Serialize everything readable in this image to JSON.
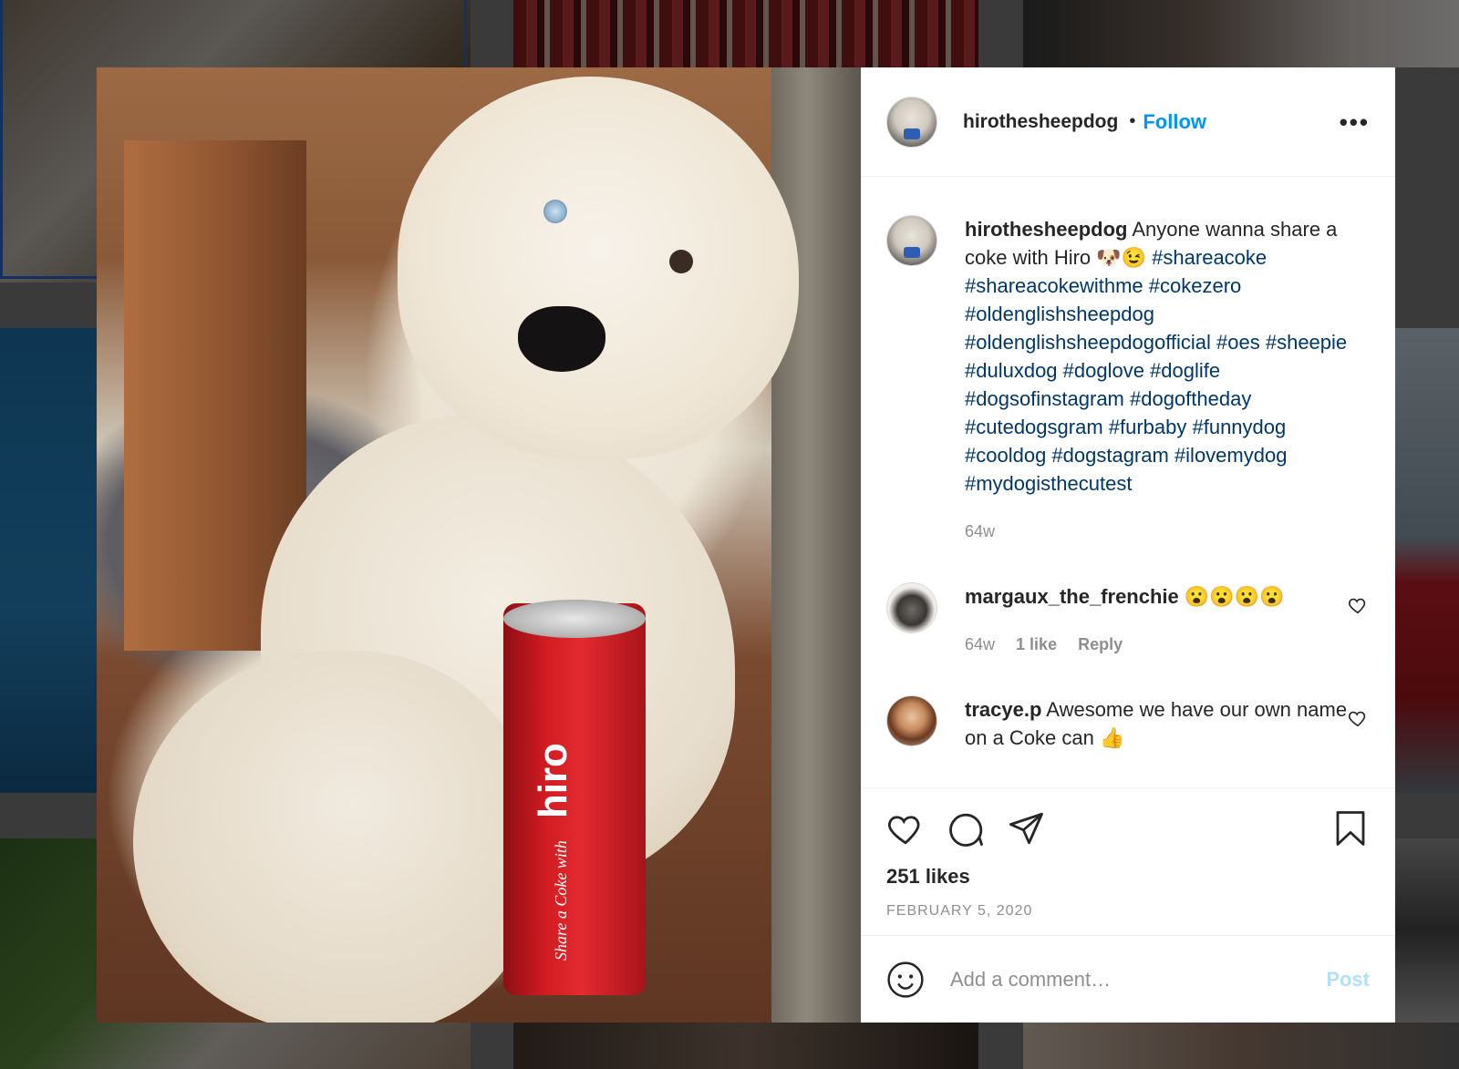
{
  "post": {
    "username": "hirothesheepdog",
    "follow_label": "Follow",
    "more_label": "•••",
    "image_alt": "Sheepdog with a Coke can",
    "can_label_small": "Share a Coke with",
    "can_label_name": "hiro"
  },
  "caption": {
    "username": "hirothesheepdog",
    "text": " Anyone wanna share a coke with Hiro 🐶😉 ",
    "hashtags": "#shareacoke #shareacokewithme #cokezero #oldenglishsheepdog #oldenglishsheepdogofficial #oes #sheepie #duluxdog #doglove #doglife #dogsofinstagram #dogoftheday #cutedogsgram #furbaby #funnydog #cooldog #dogstagram #ilovemydog #mydogisthecutest",
    "age": "64w"
  },
  "comments": [
    {
      "username": "margaux_the_frenchie",
      "text": " 😮😮😮😮",
      "age": "64w",
      "likes": "1 like",
      "reply": "Reply"
    },
    {
      "username": "tracye.p",
      "text": " Awesome we have our own name on a Coke can 👍"
    }
  ],
  "footer": {
    "likes": "251 likes",
    "date": "FEBRUARY 5, 2020",
    "comment_placeholder": "Add a comment…",
    "post_label": "Post"
  },
  "colors": {
    "accent": "#0095f6",
    "hashtag": "#00376b",
    "muted": "#8e8e8e",
    "post_disabled": "#b2dffc"
  }
}
